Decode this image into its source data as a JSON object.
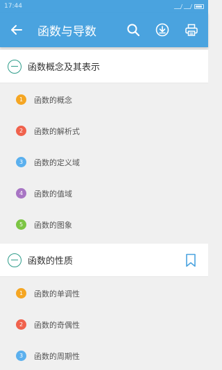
{
  "status": {
    "time": "17:44"
  },
  "header": {
    "title": "函数与导数"
  },
  "sections": [
    {
      "title": "函数概念及其表示",
      "items": [
        {
          "num": "1",
          "label": "函数的概念",
          "color": "#f5a623"
        },
        {
          "num": "2",
          "label": "函数的解析式",
          "color": "#f0624d"
        },
        {
          "num": "3",
          "label": "函数的定义域",
          "color": "#5bb0ee"
        },
        {
          "num": "4",
          "label": "函数的值域",
          "color": "#a875c4"
        },
        {
          "num": "5",
          "label": "函数的图象",
          "color": "#7cc544"
        }
      ]
    },
    {
      "title": "函数的性质",
      "items": [
        {
          "num": "1",
          "label": "函数的单调性",
          "color": "#f5a623"
        },
        {
          "num": "2",
          "label": "函数的奇偶性",
          "color": "#f0624d"
        },
        {
          "num": "3",
          "label": "函数的周期性",
          "color": "#5bb0ee"
        }
      ]
    }
  ],
  "icons": {
    "back": "arrow-left-icon",
    "search": "search-icon",
    "download": "download-icon",
    "print": "print-icon",
    "collapse": "minus-circle-icon",
    "bookmark": "bookmark-icon"
  },
  "colors": {
    "appbar": "#4aa3df",
    "accent": "#2e9c8a",
    "bookmark": "#4aa3df"
  }
}
